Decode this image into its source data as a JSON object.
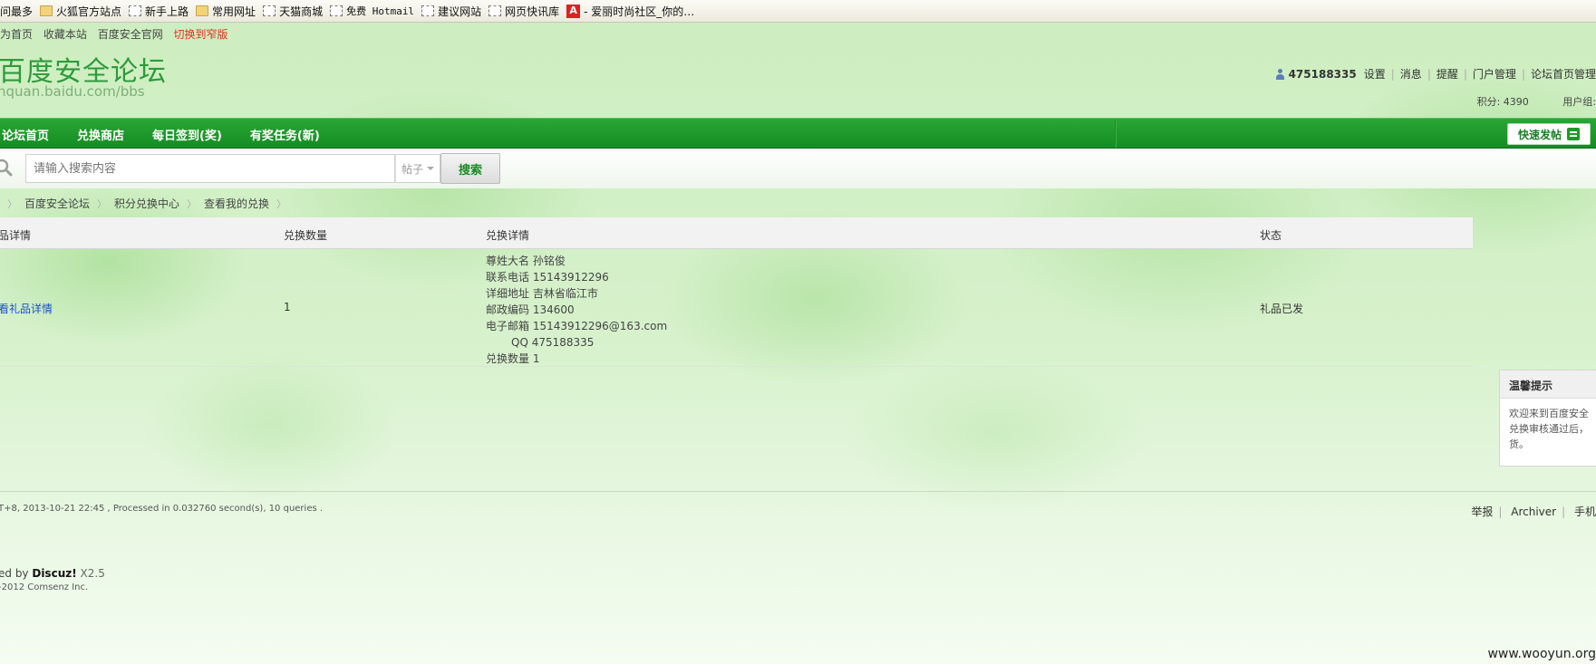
{
  "bookmarks": [
    {
      "label": "问最多",
      "icon": "none"
    },
    {
      "label": "火狐官方站点",
      "icon": "folder-icon"
    },
    {
      "label": "新手上路",
      "icon": "page-icon"
    },
    {
      "label": "常用网址",
      "icon": "folder-icon"
    },
    {
      "label": "天猫商城",
      "icon": "page-icon"
    },
    {
      "label": "免费 Hotmail",
      "icon": "page-icon"
    },
    {
      "label": "建议网站",
      "icon": "page-icon"
    },
    {
      "label": "网页快讯库",
      "icon": "page-icon"
    },
    {
      "label": "- 爱丽时尚社区_你的…",
      "icon": "a-icon"
    }
  ],
  "toplinks": {
    "set_home": "为首页",
    "bookmark": "收藏本站",
    "official": "百度安全官网",
    "switch_skin": "切换到窄版"
  },
  "logo": {
    "name": "百度安全论坛",
    "url": "nquan.baidu.com/bbs"
  },
  "user": {
    "username": "475188335",
    "links": [
      "设置",
      "消息",
      "提醒",
      "门户管理",
      "论坛首页管理"
    ],
    "credits": "积分: 4390",
    "group": "用户组:"
  },
  "nav": {
    "items": [
      "论坛首页",
      "兑换商店",
      "每日签到(奖)",
      "有奖任务(新)"
    ],
    "quick_post": "快速发帖"
  },
  "search": {
    "placeholder": "请输入搜索内容",
    "type": "帖子",
    "button": "搜索"
  },
  "breadcrumb": [
    "百度安全论坛",
    "积分兑换中心",
    "查看我的兑换"
  ],
  "table": {
    "headers": {
      "gift": "品详情",
      "qty": "兑换数量",
      "detail": "兑换详情",
      "status": "状态"
    },
    "rows": [
      {
        "gift": "看礼品详情",
        "qty": "1",
        "detail": [
          "尊姓大名 孙铭俊",
          "联系电话 15143912296",
          "详细地址 吉林省临江市",
          "邮政编码 134600",
          "电子邮箱 15143912296@163.com",
          "QQ 475188335",
          "兑换数量 1"
        ],
        "status": "礼品已发"
      }
    ]
  },
  "tip": {
    "title": "温馨提示",
    "lines": [
      "欢迎来到百度安全",
      "兑换审核通过后，",
      "货。"
    ]
  },
  "footer": {
    "gmt": "T+8, 2013-10-21 22:45 , Processed in 0.032760 second(s), 10 queries .",
    "links": [
      "举报",
      "Archiver",
      "手机"
    ],
    "powered_prefix": "ed by ",
    "powered_brand": "Discuz!",
    "powered_version": " X2.5",
    "copyright": "-2012 Comsenz Inc."
  },
  "watermark": "www.wooyun.org"
}
